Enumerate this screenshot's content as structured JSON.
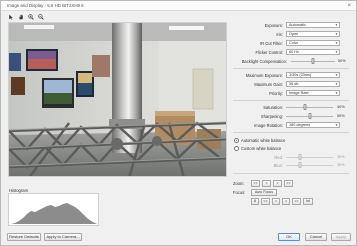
{
  "window": {
    "title": "Image and Display - 5.6 HD BIT2XH8 8"
  },
  "toolbar": {
    "tools": [
      "pointer-tool",
      "hand-tool",
      "zoom-in-tool",
      "zoom-out-tool"
    ]
  },
  "histogram": {
    "label": "Histogram"
  },
  "settings": {
    "exposure": {
      "label": "Exposure:",
      "value": "Automatic"
    },
    "iris": {
      "label": "Iris:",
      "value": "Open"
    },
    "ir_cut_filter": {
      "label": "IR Cut Filter:",
      "value": "Color"
    },
    "flicker_control": {
      "label": "Flicker Control:",
      "value": "60 Hz"
    },
    "backlight_compensation": {
      "label": "Backlight Compensation:",
      "value": 50,
      "display": "50%"
    },
    "maximum_exposure": {
      "label": "Maximum Exposure:",
      "value": "1/30s (33ms)"
    },
    "maximum_gain": {
      "label": "Maximum Gain:",
      "value": "36 db"
    },
    "priority": {
      "label": "Priority:",
      "value": "Image Rate"
    },
    "saturation": {
      "label": "Saturation:",
      "value": 40,
      "display": "40%"
    },
    "sharpening": {
      "label": "Sharpening:",
      "value": 50,
      "display": "50%"
    },
    "image_rotation": {
      "label": "Image Rotation:",
      "value": "180 degrees"
    }
  },
  "white_balance": {
    "auto_label": "Automatic white balance",
    "custom_label": "Custom white balance",
    "selected": "auto",
    "red": {
      "label": "Red:",
      "value": 30,
      "display": "30%"
    },
    "blue": {
      "label": "Blue:",
      "value": 30,
      "display": "30%"
    }
  },
  "zoom": {
    "label": "Zoom:",
    "buttons": [
      "<<",
      "<",
      ">",
      ">>"
    ]
  },
  "focus": {
    "label": "Focus:",
    "auto_label": "Auto Focus",
    "buttons": [
      "8",
      "<<",
      "<",
      ">",
      ">>",
      "Inf"
    ]
  },
  "footer": {
    "restore_label": "Restore Defaults",
    "apply_camera_label": "Apply to Camera...",
    "ok_label": "OK",
    "cancel_label": "Cancel",
    "apply_label": "Apply"
  },
  "colors": {
    "accent": "#3465a4",
    "window_bg": "#f0f0f0",
    "border": "#adadad"
  }
}
